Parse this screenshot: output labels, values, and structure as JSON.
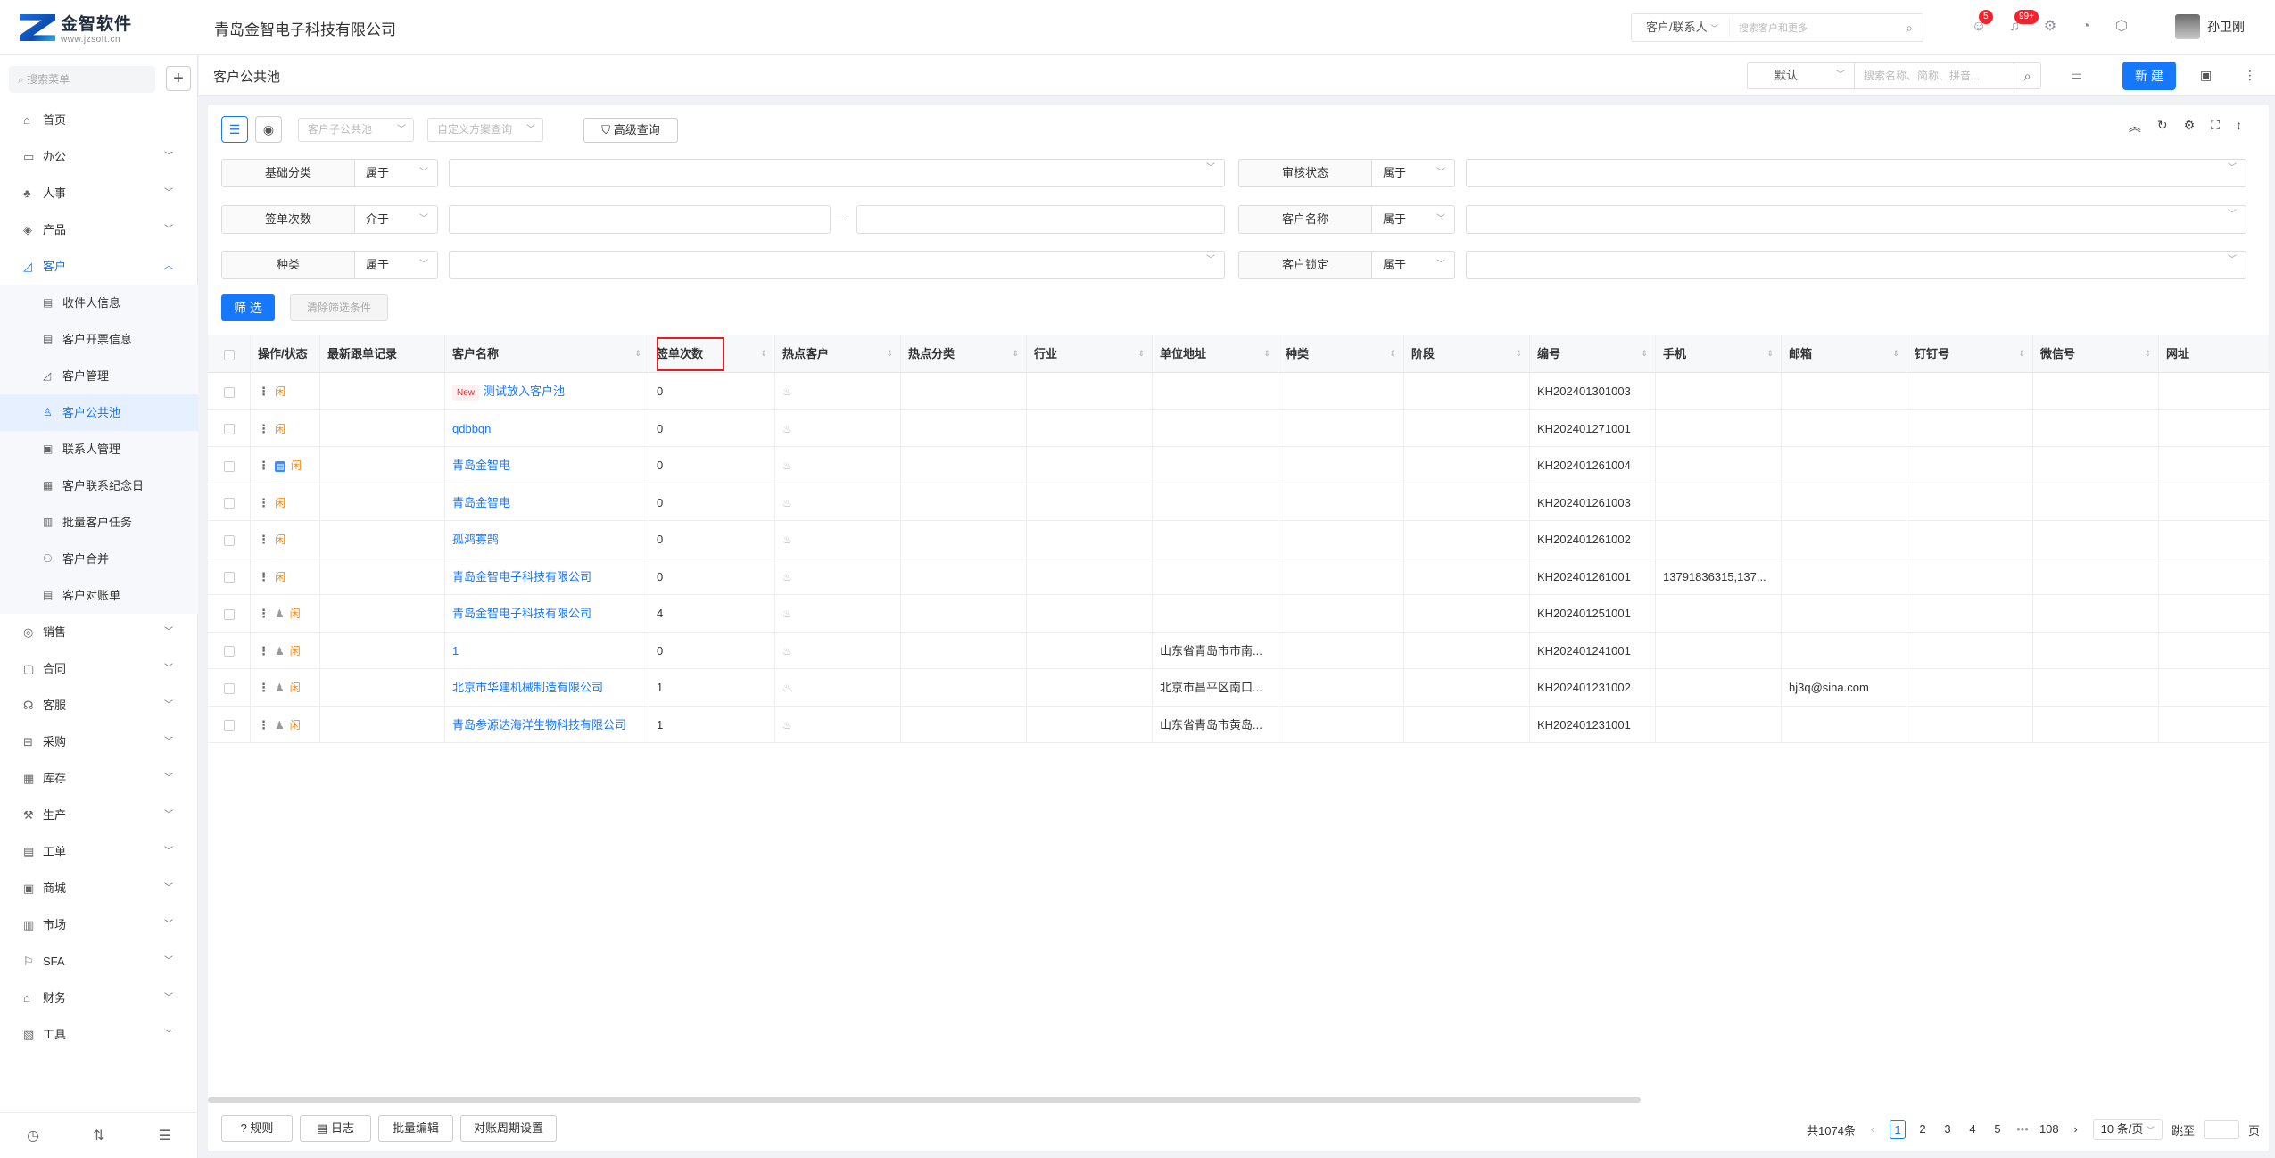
{
  "app": {
    "logo_text": "金智软件",
    "logo_url": "www.jzsoft.cn",
    "company": "青岛金智电子科技有限公司"
  },
  "topbar": {
    "search_scope": "客户/联系人",
    "search_placeholder": "搜索客户和更多",
    "badge_notify": "5",
    "badge_msg": "99+",
    "user_name": "孙卫刚"
  },
  "sidebar": {
    "search_placeholder": "搜索菜单",
    "menu_top": [
      {
        "label": "首页",
        "icon": "home-icon"
      },
      {
        "label": "办公",
        "icon": "office-icon"
      },
      {
        "label": "人事",
        "icon": "people-icon"
      },
      {
        "label": "产品",
        "icon": "product-icon"
      },
      {
        "label": "客户",
        "icon": "customer-icon"
      }
    ],
    "submenu": [
      {
        "label": "收件人信息"
      },
      {
        "label": "客户开票信息"
      },
      {
        "label": "客户管理"
      },
      {
        "label": "客户公共池"
      },
      {
        "label": "联系人管理"
      },
      {
        "label": "客户联系纪念日"
      },
      {
        "label": "批量客户任务"
      },
      {
        "label": "客户合并"
      },
      {
        "label": "客户对账单"
      }
    ],
    "menu_bottom": [
      {
        "label": "销售"
      },
      {
        "label": "合同"
      },
      {
        "label": "客服"
      },
      {
        "label": "采购"
      },
      {
        "label": "库存"
      },
      {
        "label": "生产"
      },
      {
        "label": "工单"
      },
      {
        "label": "商城"
      },
      {
        "label": "市场"
      },
      {
        "label": "SFA"
      },
      {
        "label": "财务"
      },
      {
        "label": "工具"
      }
    ]
  },
  "page": {
    "title": "客户公共池",
    "view_select": "默认",
    "search_placeholder": "搜索名称、简称、拼音...",
    "new_button": "新 建"
  },
  "toolbar": {
    "pool_select": "客户子公共池",
    "scheme_select": "自定义方案查询",
    "advanced": "高级查询"
  },
  "filters": [
    {
      "label": "基础分类",
      "op": "属于",
      "value": ""
    },
    {
      "label": "审核状态",
      "op": "属于",
      "value": ""
    },
    {
      "label": "签单次数",
      "op": "介于",
      "value": ""
    },
    {
      "label": "客户名称",
      "op": "属于",
      "value": ""
    },
    {
      "label": "种类",
      "op": "属于",
      "value": ""
    },
    {
      "label": "客户锁定",
      "op": "属于",
      "value": ""
    }
  ],
  "filter_buttons": {
    "apply": "筛 选",
    "clear": "清除筛选条件"
  },
  "table": {
    "columns": [
      "操作/状态",
      "最新跟单记录",
      "客户名称",
      "签单次数",
      "热点客户",
      "热点分类",
      "行业",
      "单位地址",
      "种类",
      "阶段",
      "编号",
      "手机",
      "邮箱",
      "钉钉号",
      "微信号",
      "网址"
    ],
    "rows": [
      {
        "badge": "New",
        "name": "测试放入客户池",
        "count": "0",
        "address": "",
        "code": "KH202401301003",
        "phone": "",
        "email": "",
        "icons": ""
      },
      {
        "badge": "",
        "name": "qdbbqn",
        "count": "0",
        "address": "",
        "code": "KH202401271001",
        "phone": "",
        "email": "",
        "icons": ""
      },
      {
        "badge": "",
        "name": "青岛金智电",
        "count": "0",
        "address": "",
        "code": "KH202401261004",
        "phone": "",
        "email": "",
        "icons": "doc"
      },
      {
        "badge": "",
        "name": "青岛金智电",
        "count": "0",
        "address": "",
        "code": "KH202401261003",
        "phone": "",
        "email": "",
        "icons": ""
      },
      {
        "badge": "",
        "name": "孤鸿寡鹄",
        "count": "0",
        "address": "",
        "code": "KH202401261002",
        "phone": "",
        "email": "",
        "icons": ""
      },
      {
        "badge": "",
        "name": "青岛金智电子科技有限公司",
        "count": "0",
        "address": "",
        "code": "KH202401261001",
        "phone": "13791836315,137...",
        "email": "",
        "icons": ""
      },
      {
        "badge": "",
        "name": "青岛金智电子科技有限公司",
        "count": "4",
        "address": "",
        "code": "KH202401251001",
        "phone": "",
        "email": "",
        "icons": "user"
      },
      {
        "badge": "",
        "name": "1",
        "count": "0",
        "address": "山东省青岛市市南...",
        "code": "KH202401241001",
        "phone": "",
        "email": "",
        "icons": "user"
      },
      {
        "badge": "",
        "name": "北京市华建机械制造有限公司",
        "count": "1",
        "address": "北京市昌平区南口...",
        "code": "KH202401231002",
        "phone": "",
        "email": "hj3q@sina.com",
        "icons": "user"
      },
      {
        "badge": "",
        "name": "青岛参源达海洋生物科技有限公司",
        "count": "1",
        "address": "山东省青岛市黄岛...",
        "code": "KH202401231001",
        "phone": "",
        "email": "",
        "icons": "user"
      }
    ],
    "status_tag": "闲"
  },
  "footer": {
    "buttons": [
      "规则",
      "日志",
      "批量编辑",
      "对账周期设置"
    ],
    "total": "共1074条",
    "pages": [
      "1",
      "2",
      "3",
      "4",
      "5",
      "•••",
      "108"
    ],
    "page_size": "10 条/页",
    "jump_label": "跳至",
    "page_unit": "页"
  },
  "colors": {
    "accent": "#1677ff",
    "highlight_box": "#e02020",
    "status_tag": "#fa8c16"
  }
}
